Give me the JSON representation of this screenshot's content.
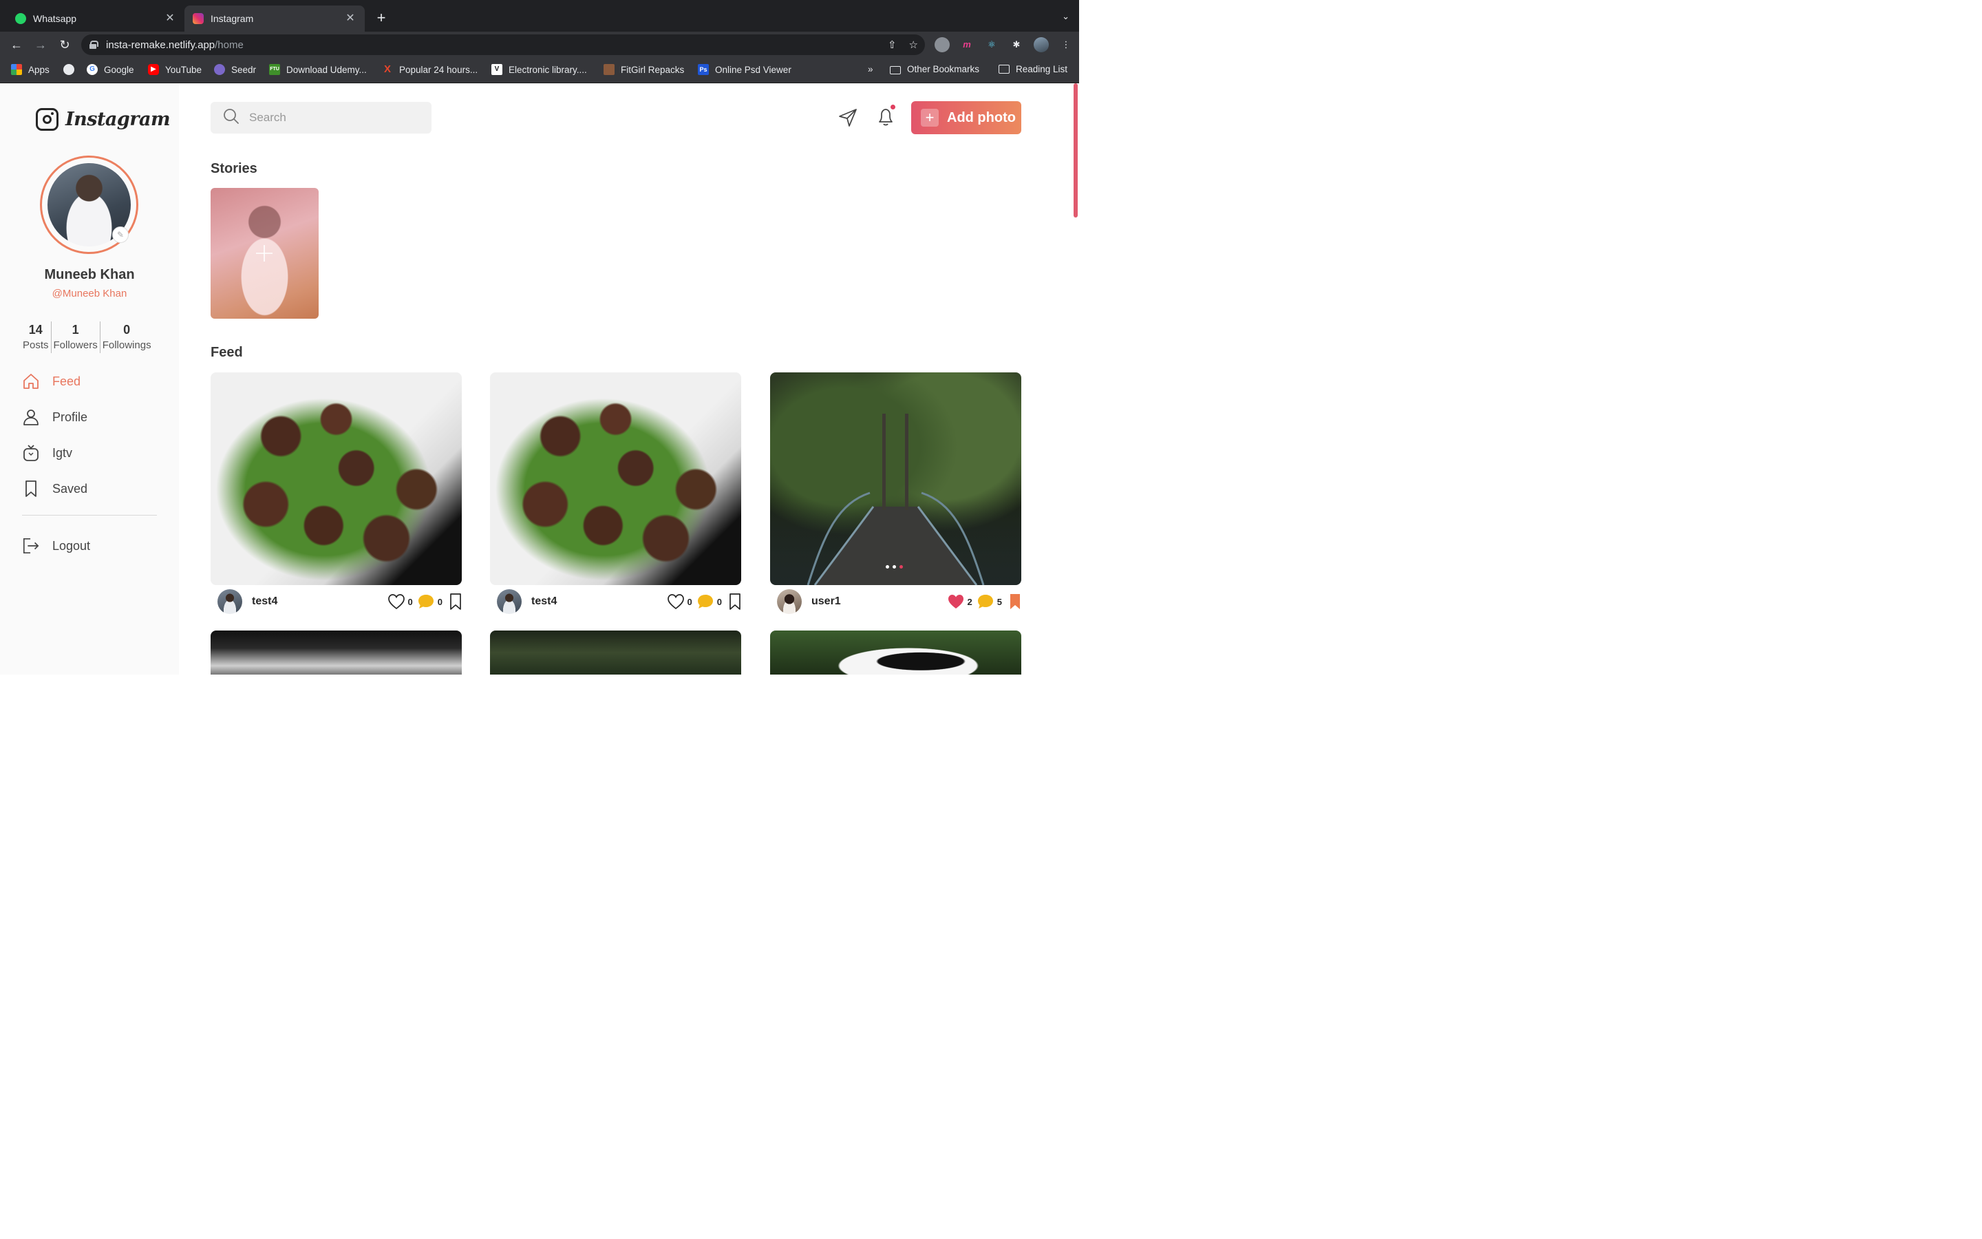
{
  "browser": {
    "tabs": [
      {
        "title": "Whatsapp",
        "favicon_color": "#25d366",
        "active": false
      },
      {
        "title": "Instagram",
        "favicon_color": "#e1306c",
        "active": true
      }
    ],
    "new_tab_icon": "plus-icon",
    "address": {
      "host": "insta-remake.netlify.app",
      "path": "/home"
    },
    "bookmarks": [
      {
        "label": "Apps",
        "icon": "apps-grid-icon"
      },
      {
        "label": "",
        "icon": "globe-icon"
      },
      {
        "label": "Google",
        "icon": "google-icon"
      },
      {
        "label": "YouTube",
        "icon": "youtube-icon"
      },
      {
        "label": "Seedr",
        "icon": "seedr-icon"
      },
      {
        "label": "Download Udemy...",
        "icon": "ftu-icon"
      },
      {
        "label": "Popular 24 hours...",
        "icon": "x-icon"
      },
      {
        "label": "Electronic library....",
        "icon": "v-icon"
      },
      {
        "label": "FitGirl Repacks",
        "icon": "fitgirl-icon"
      },
      {
        "label": "Online Psd Viewer",
        "icon": "ps-icon"
      }
    ],
    "more_bookmarks": "»",
    "other_bookmarks": "Other Bookmarks",
    "reading_list": "Reading List"
  },
  "sidebar": {
    "logo_text": "Instagram",
    "profile": {
      "name": "Muneeb Khan",
      "handle": "@Muneeb Khan"
    },
    "stats": [
      {
        "value": "14",
        "label": "Posts"
      },
      {
        "value": "1",
        "label": "Followers"
      },
      {
        "value": "0",
        "label": "Followings"
      }
    ],
    "nav": [
      {
        "label": "Feed",
        "icon": "home-icon",
        "active": true
      },
      {
        "label": "Profile",
        "icon": "user-icon",
        "active": false
      },
      {
        "label": "Igtv",
        "icon": "igtv-icon",
        "active": false
      },
      {
        "label": "Saved",
        "icon": "bookmark-icon",
        "active": false
      }
    ],
    "logout_label": "Logout"
  },
  "header": {
    "search_placeholder": "Search",
    "add_photo_label": "Add photo",
    "accent": "#e2566a"
  },
  "stories": {
    "title": "Stories"
  },
  "feed": {
    "title": "Feed",
    "posts": [
      {
        "user": "test4",
        "likes": "0",
        "comments": "0",
        "liked": false,
        "saved": false,
        "image": "meatballs"
      },
      {
        "user": "test4",
        "likes": "0",
        "comments": "0",
        "liked": false,
        "saved": false,
        "image": "meatballs"
      },
      {
        "user": "user1",
        "likes": "2",
        "comments": "5",
        "liked": true,
        "saved": true,
        "image": "forest-bridge",
        "slides": 3,
        "active_slide": 3
      }
    ]
  }
}
